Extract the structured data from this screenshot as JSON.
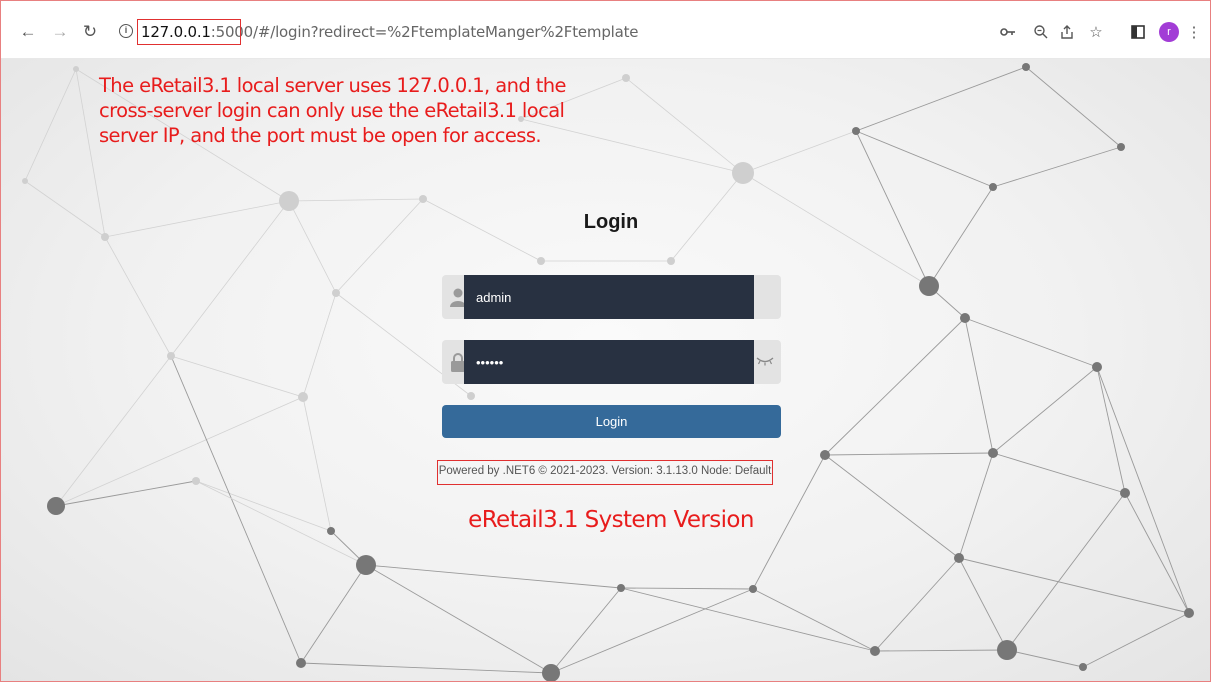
{
  "browser": {
    "url_host": "127.0.0.1",
    "url_port": ":5000/",
    "url_path": "#/login?redirect=%2FtemplateManger%2Ftemplate",
    "profile_initial": "r",
    "icons": [
      "back-icon",
      "forward-icon",
      "reload-icon",
      "site-info-icon",
      "key-icon",
      "zoom-icon",
      "share-icon",
      "star-icon",
      "sidepanel-icon",
      "menu-icon"
    ]
  },
  "annotation": {
    "lines": [
      "The eRetail3.1 local server uses 127.0.0.1, and the",
      "cross-server login can only use the eRetail3.1 local",
      "server IP, and the port must be open for access."
    ],
    "color": "#e81c1c"
  },
  "login": {
    "title": "Login",
    "username_value": "admin",
    "password_value": "••••••",
    "button_label": "Login",
    "footer": "Powered by .NET6 © 2021-2023. Version: 3.1.13.0 Node: Default",
    "version_caption": "eRetail3.1 System Version"
  },
  "colors": {
    "input_bg": "#283141",
    "button_bg": "#356a9a",
    "highlight": "#e03030",
    "avatar": "#a23cd6"
  }
}
